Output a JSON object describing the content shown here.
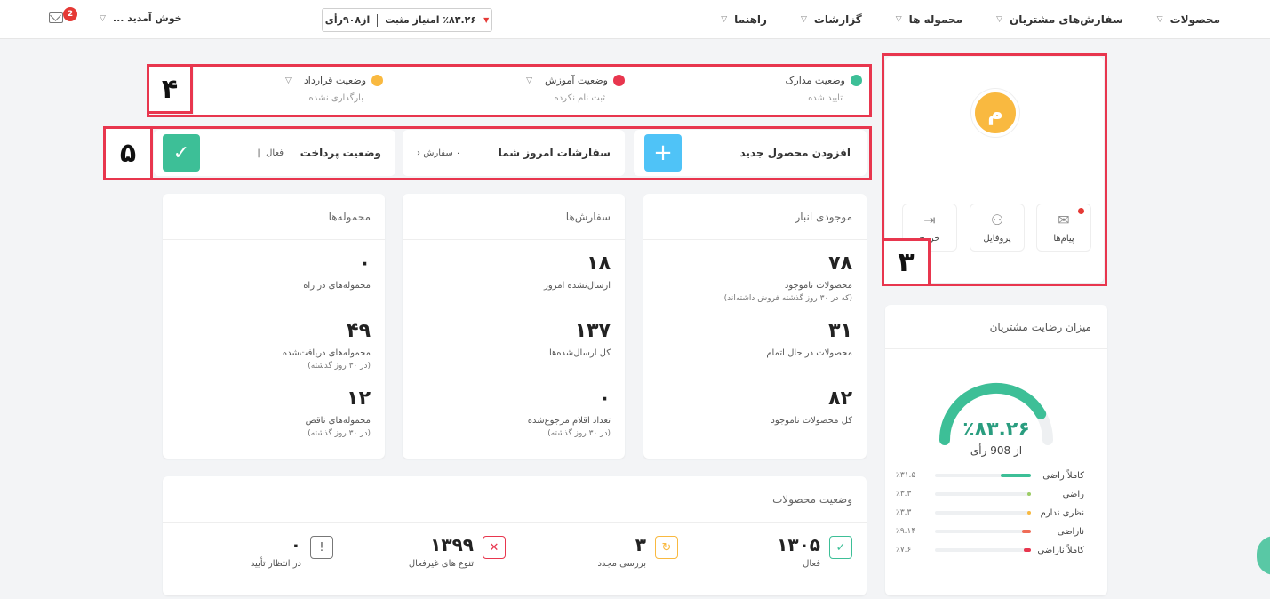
{
  "nav": {
    "items": [
      "محصولات",
      "سفارش‌های مشتریان",
      "محموله ها",
      "گزارشات",
      "راهنما"
    ],
    "rating_percent": "٪۸۳.۲۶ امتیاز مثبت",
    "rating_votes": "از۹۰۸رأی",
    "welcome": "خوش آمدید ...",
    "mail_badge": "2"
  },
  "markers": {
    "m3": "۳",
    "m4": "۴",
    "m5": "۵"
  },
  "status": {
    "docs": {
      "label": "وضعیت مدارک",
      "value": "تایید شده",
      "color": "#3dbf97"
    },
    "training": {
      "label": "وضعیت آموزش",
      "value": "ثبت نام نکرده",
      "color": "#e8364e"
    },
    "contract": {
      "label": "وضعیت قرارداد",
      "value": "بارگذاری نشده",
      "color": "#f9b940"
    }
  },
  "actions": {
    "add_product": "افزودن محصول جدید",
    "today_orders": "سفارشات امروز شما",
    "today_orders_count": "۰ سفارش",
    "payment_status": "وضعیت پرداخت",
    "payment_value": "فعال"
  },
  "inventory": {
    "title": "موجودی انبار",
    "s1": {
      "v": "۷۸",
      "t": "محصولات ناموجود",
      "n": "(که در ۳۰ روز گذشته فروش داشته‌اند)"
    },
    "s2": {
      "v": "۳۱",
      "t": "محصولات در حال اتمام"
    },
    "s3": {
      "v": "۸۲",
      "t": "کل محصولات ناموجود"
    }
  },
  "orders": {
    "title": "سفارش‌ها",
    "s1": {
      "v": "۱۸",
      "t": "ارسال‌نشده امروز"
    },
    "s2": {
      "v": "۱۳۷",
      "t": "کل ارسال‌شده‌ها"
    },
    "s3": {
      "v": "۰",
      "t": "تعداد اقلام مرجوع‌شده",
      "n": "(در ۳۰ روز گذشته)"
    }
  },
  "shipments": {
    "title": "محموله‌ها",
    "s1": {
      "v": "۰",
      "t": "محموله‌های در راه"
    },
    "s2": {
      "v": "۴۹",
      "t": "محموله‌های دریافت‌شده",
      "n": "(در ۳۰ روز گذشته)"
    },
    "s3": {
      "v": "۱۲",
      "t": "محموله‌های ناقص",
      "n": "(در ۳۰ روز گذشته)"
    }
  },
  "products_status": {
    "title": "وضعیت محصولات",
    "active": {
      "v": "۱۳۰۵",
      "t": "فعال"
    },
    "review": {
      "v": "۳",
      "t": "بررسی مجدد"
    },
    "inactive": {
      "v": "۱۳۹۹",
      "t": "تنوع های غیرفعال"
    },
    "pending": {
      "v": "۰",
      "t": "در انتظار تأیید"
    }
  },
  "profile": {
    "avatar_letter": "م",
    "messages": "پیام‌ها",
    "profile": "پروفایل",
    "logout": "خروج"
  },
  "satisfaction": {
    "title": "میزان رضایت مشتریان",
    "percent_label": "٪۸۳.۲۶",
    "percent_value": 83.26,
    "votes": "از 908 رأی",
    "rows": [
      {
        "label": "کاملاً راضی",
        "pct": "٪۳۱.۵",
        "value": 31.5,
        "color": "#3dbf97"
      },
      {
        "label": "راضی",
        "pct": "٪۳.۳",
        "value": 3.3,
        "color": "#9ccc65"
      },
      {
        "label": "نظری ندارم",
        "pct": "٪۳.۳",
        "value": 3.3,
        "color": "#f9b940"
      },
      {
        "label": "ناراضی",
        "pct": "٪۹.۱۴",
        "value": 9.14,
        "color": "#ef6c57"
      },
      {
        "label": "کاملاً ناراضی",
        "pct": "٪۷.۶",
        "value": 7.6,
        "color": "#e8364e"
      }
    ]
  }
}
